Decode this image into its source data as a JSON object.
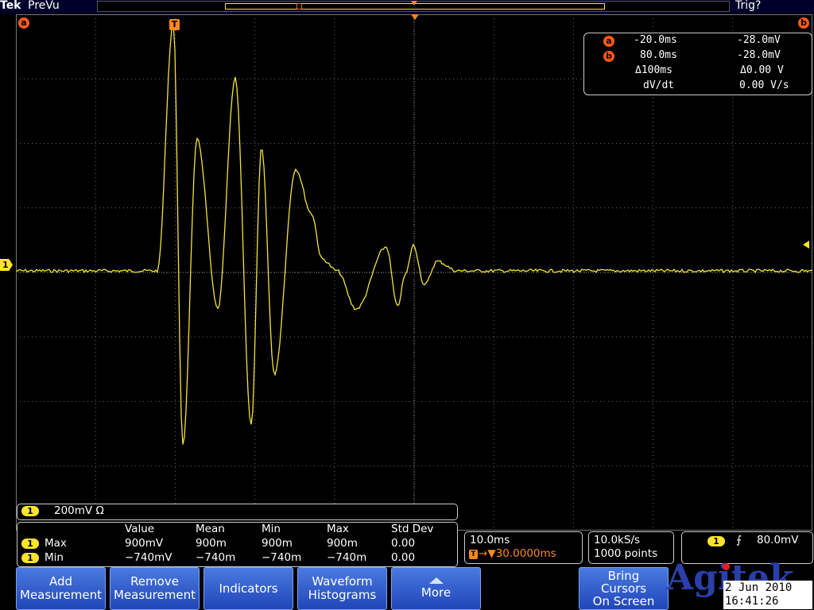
{
  "topbar": {
    "brand": "Tek",
    "mode": "PreVu",
    "trigger_status": "Trig?"
  },
  "markers": {
    "cursor_a": "a",
    "cursor_b": "b",
    "trigger": "T",
    "channel": "1"
  },
  "cursor_readout": {
    "a_time": "-20.0ms",
    "a_volt": "-28.0mV",
    "b_time": "80.0ms",
    "b_volt": "-28.0mV",
    "delta_time": "Δ100ms",
    "delta_volt": "Δ0.00 V",
    "dvdt_label": "dV/dt",
    "dvdt_value": "0.00 V/s"
  },
  "channel": {
    "number": "1",
    "scale": "200mV Ω",
    "color": "#ffe42b"
  },
  "measurements": {
    "headers": [
      "Value",
      "Mean",
      "Min",
      "Max",
      "Std Dev"
    ],
    "rows": [
      {
        "ch": "1",
        "name": "Max",
        "value": "900mV",
        "mean": "900m",
        "min": "900m",
        "max": "900m",
        "std": "0.00"
      },
      {
        "ch": "1",
        "name": "Min",
        "value": "−740mV",
        "mean": "−740m",
        "min": "−740m",
        "max": "−740m",
        "std": "0.00"
      }
    ]
  },
  "horizontal": {
    "scale": "10.0ms",
    "position": "→▼30.0000ms"
  },
  "acquisition": {
    "rate": "10.0kS/s",
    "points": "1000 points"
  },
  "trigger": {
    "ch": "1",
    "slope": "⨍",
    "level": "80.0mV"
  },
  "buttons": {
    "add_measurement": [
      "Add",
      "Measurement"
    ],
    "remove_measurement": [
      "Remove",
      "Measurement"
    ],
    "indicators": "Indicators",
    "waveform_histograms": [
      "Waveform",
      "Histograms"
    ],
    "more": "More",
    "bring_cursors": [
      "Bring",
      "Cursors",
      "On Screen"
    ]
  },
  "watermark": "Agitek",
  "datetime": {
    "date": "2 Jun 2010",
    "time": "16:41:26"
  },
  "trace_color": "#f5e33a",
  "accent_color": "#ff5a1a"
}
